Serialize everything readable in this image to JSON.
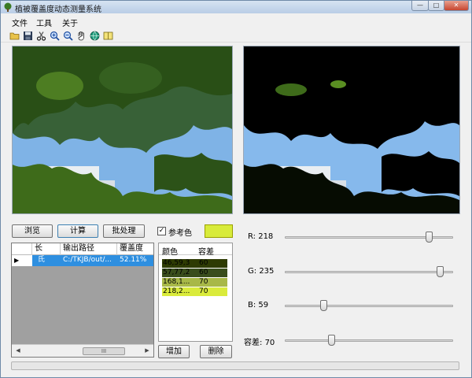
{
  "window": {
    "title": "植被覆盖度动态测量系统",
    "min_glyph": "—",
    "max_glyph": "□",
    "close_glyph": "✕"
  },
  "menu": {
    "items": [
      "文件",
      "工具",
      "关于"
    ]
  },
  "toolbar": {
    "tools": [
      "open-folder-icon",
      "save-icon",
      "cut-icon",
      "zoom-in-icon",
      "zoom-out-icon",
      "pan-hand-icon",
      "globe-icon",
      "split-view-icon"
    ]
  },
  "buttons": {
    "browse": "浏览",
    "compute": "计算",
    "batch": "批处理",
    "add": "增加",
    "delete": "删除"
  },
  "reference_color": {
    "label": "参考色",
    "checked": true,
    "check_glyph": "✓",
    "swatch": "#d8eb3a"
  },
  "results_grid": {
    "columns": [
      " ",
      "长",
      "输出路径",
      "覆盖度"
    ],
    "rows": [
      {
        "marker": "▶",
        "cell1": "",
        "cell2": "氏",
        "path": "C:/TKJB/out/...",
        "coverage": "52.11%"
      }
    ],
    "scroll_thumb_glyph": "III"
  },
  "color_grid": {
    "columns": [
      "颜色",
      "容差"
    ],
    "rows": [
      {
        "color": "46,59,3",
        "tolerance": "60",
        "bg": "#2e3b03",
        "fg": "#000000"
      },
      {
        "color": "57,77,28",
        "tolerance": "60",
        "bg": "#394d1c",
        "fg": "#000000"
      },
      {
        "color": "168,1...",
        "tolerance": "70",
        "bg": "#a8b848",
        "fg": "#000000"
      },
      {
        "color": "218,2...",
        "tolerance": "70",
        "bg": "#daeb3b",
        "fg": "#000000"
      }
    ]
  },
  "sliders": [
    {
      "label": "R:",
      "value": "218",
      "fraction": 0.855
    },
    {
      "label": "G:",
      "value": "235",
      "fraction": 0.922
    },
    {
      "label": "B:",
      "value": "59",
      "fraction": 0.231
    },
    {
      "label": "容差:",
      "value": "70",
      "fraction": 0.275
    }
  ],
  "progress": {
    "fraction": 0
  },
  "colors": {
    "sky": "#7fb3e6",
    "foliage_dark": "#1f3d12",
    "foliage_light": "#3e6b1a",
    "mask": "#000000"
  }
}
